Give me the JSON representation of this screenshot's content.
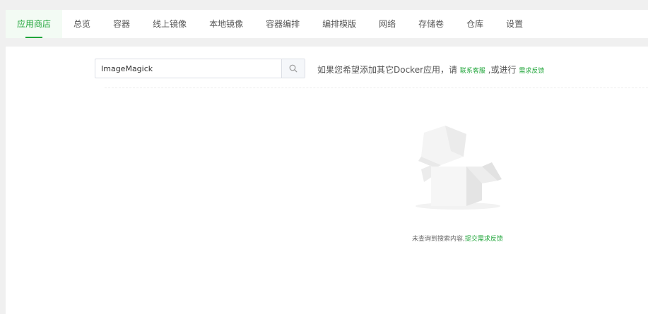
{
  "tabs": [
    {
      "label": "应用商店",
      "active": true
    },
    {
      "label": "总览"
    },
    {
      "label": "容器"
    },
    {
      "label": "线上镜像"
    },
    {
      "label": "本地镜像"
    },
    {
      "label": "容器编排"
    },
    {
      "label": "编排模版"
    },
    {
      "label": "网络"
    },
    {
      "label": "存储卷"
    },
    {
      "label": "仓库"
    },
    {
      "label": "设置"
    }
  ],
  "search": {
    "value": "ImageMagick",
    "icon": "search-icon"
  },
  "hint": {
    "prefix": "如果您希望添加其它Docker应用，请",
    "contact_link": "联系客服",
    "middle": ",或进行",
    "feedback_link": "需求反馈"
  },
  "empty": {
    "text": "未查询到搜索内容,",
    "link": "提交需求反馈",
    "icon": "empty-box-illustration"
  },
  "colors": {
    "accent": "#20a53a",
    "background": "#f0f0f0"
  }
}
